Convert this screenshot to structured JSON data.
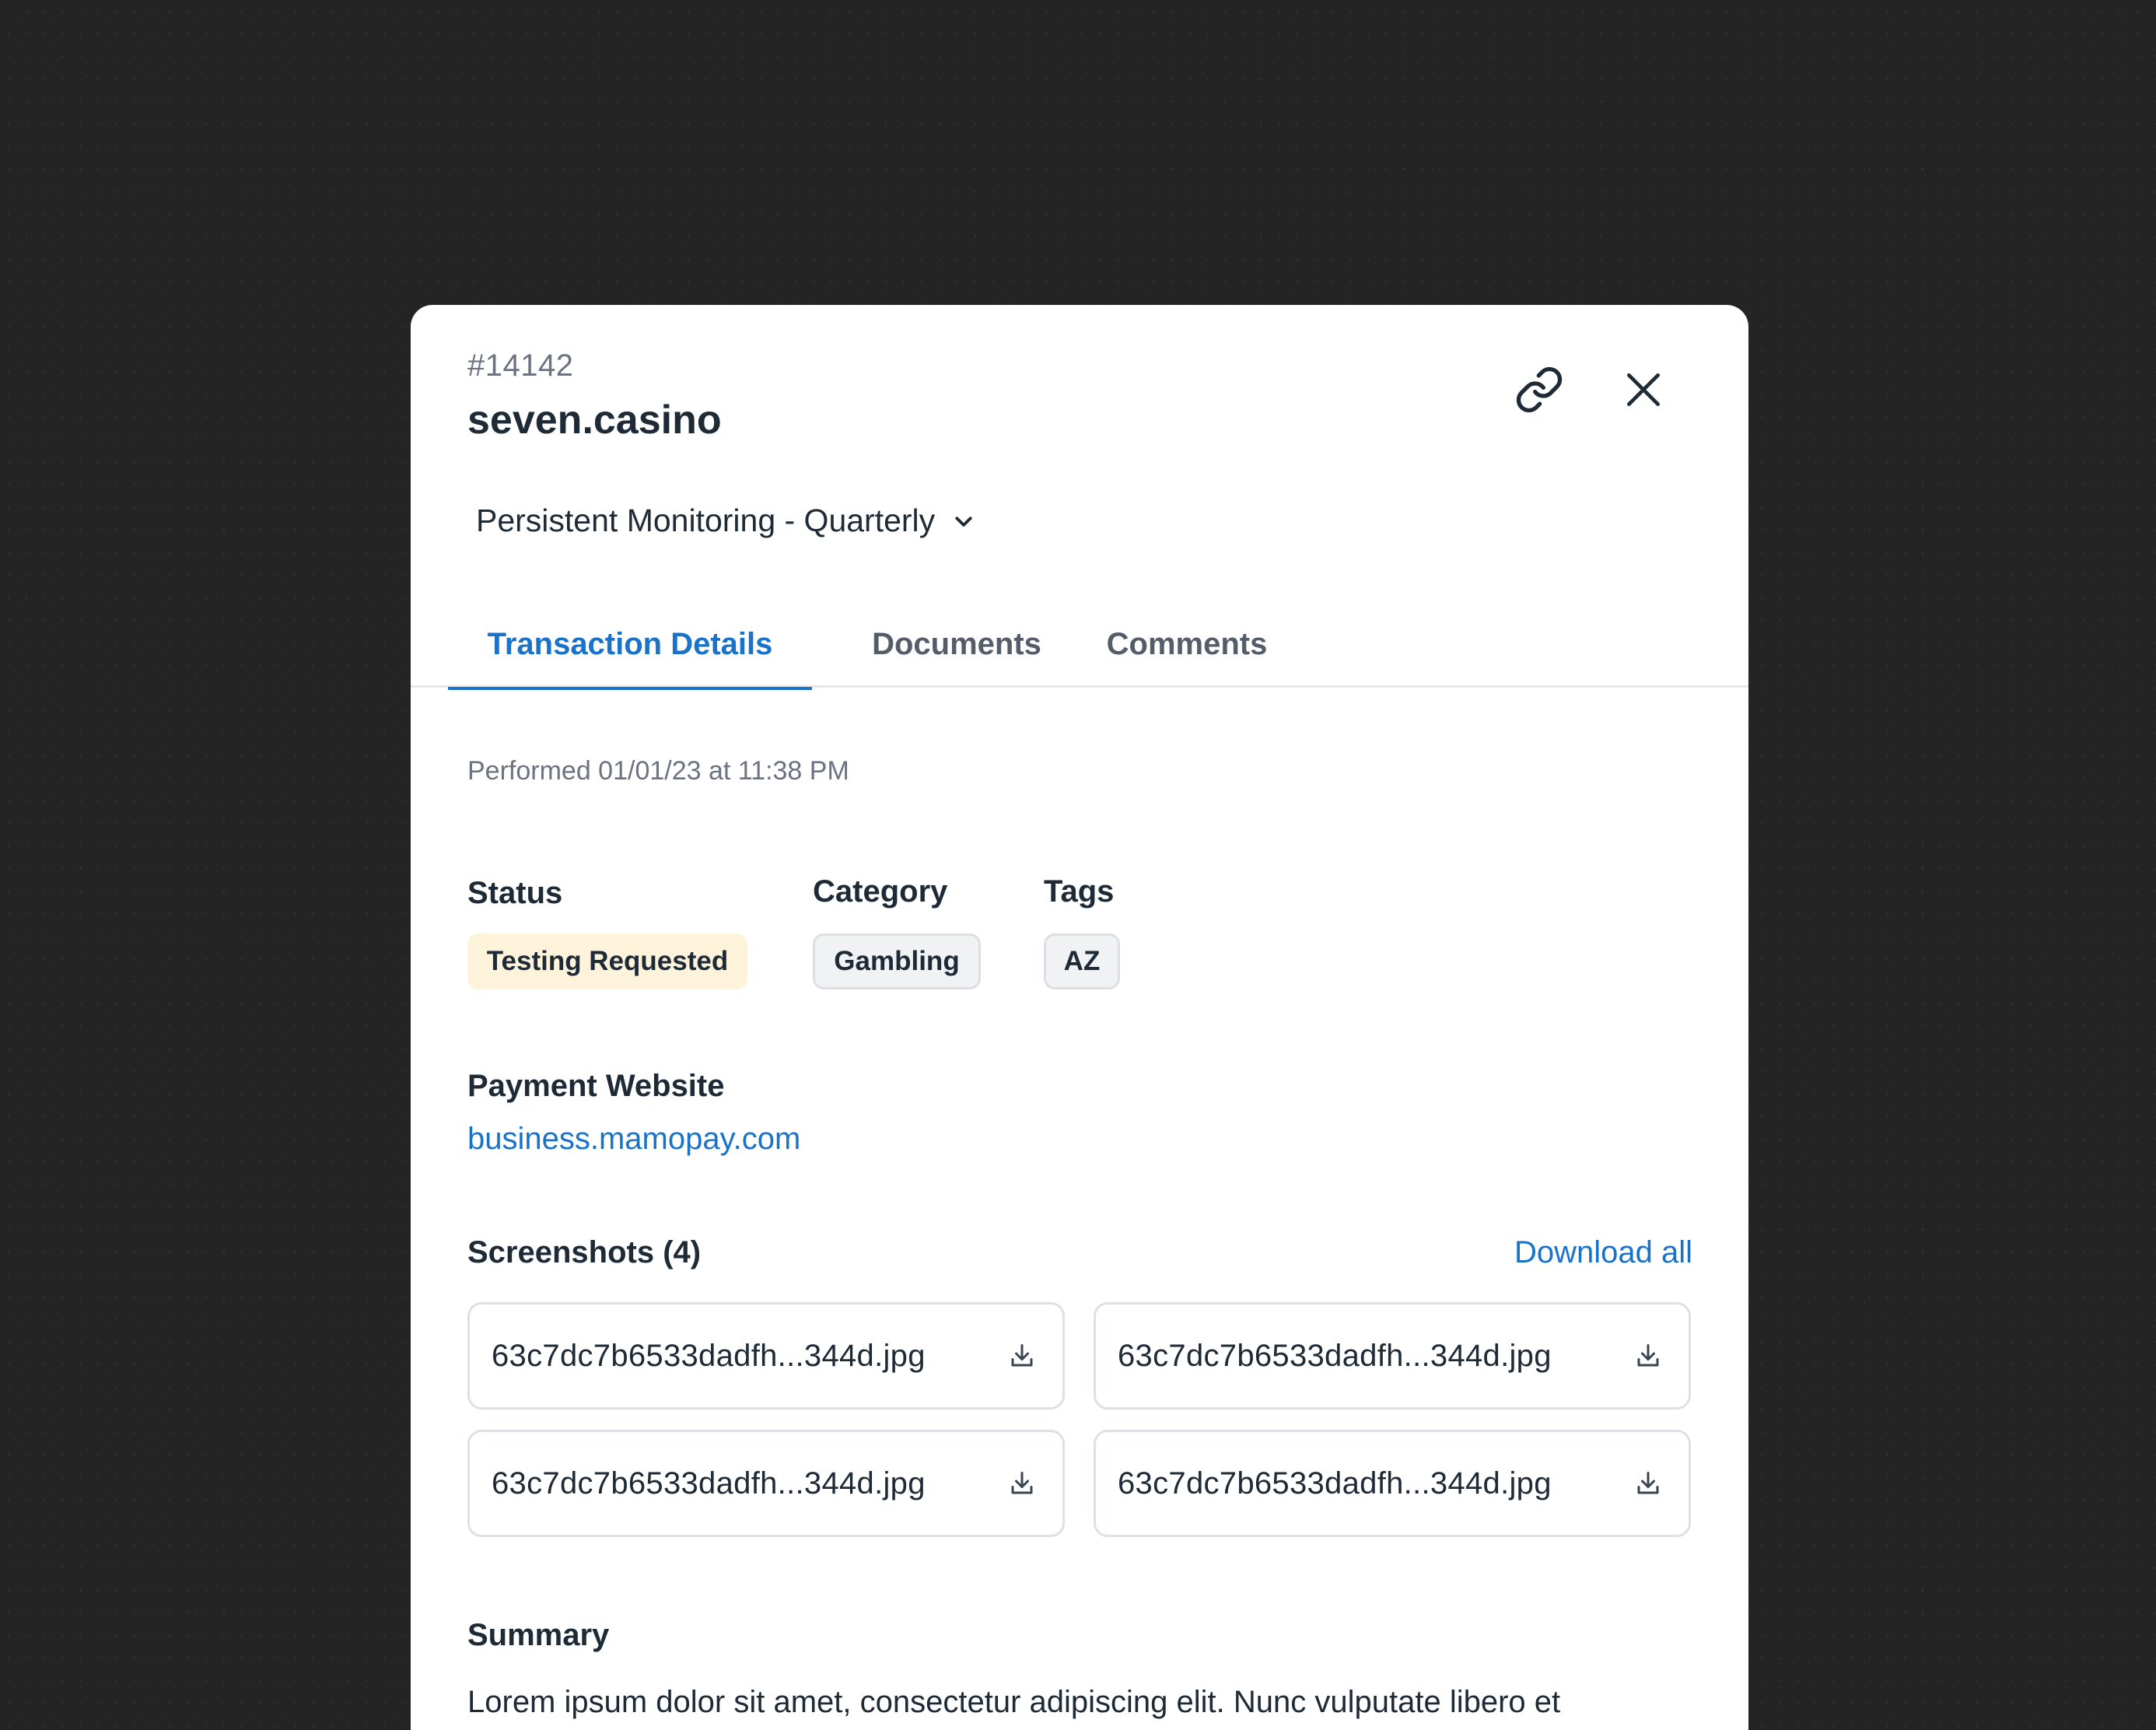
{
  "header": {
    "ticket_id": "#14142",
    "title": "seven.casino"
  },
  "icons": {
    "link": "link-icon",
    "close": "close-icon",
    "chevron": "chevron-down-icon",
    "download": "download-icon"
  },
  "monitoring": {
    "selected": "Persistent Monitoring - Quarterly"
  },
  "tabs": [
    {
      "label": "Transaction Details",
      "active": true
    },
    {
      "label": "Documents",
      "active": false
    },
    {
      "label": "Comments",
      "active": false
    }
  ],
  "details": {
    "performed": "Performed 01/01/23 at 11:38 PM",
    "status_label": "Status",
    "status_value": "Testing Requested",
    "category_label": "Category",
    "category_value": "Gambling",
    "tags_label": "Tags",
    "tags": [
      "AZ"
    ],
    "website_label": "Payment Website",
    "website_value": "business.mamopay.com"
  },
  "screenshots": {
    "label": "Screenshots (4)",
    "download_all": "Download all",
    "files": [
      "63c7dc7b6533dadfh...344d.jpg",
      "63c7dc7b6533dadfh...344d.jpg",
      "63c7dc7b6533dadfh...344d.jpg",
      "63c7dc7b6533dadfh...344d.jpg"
    ]
  },
  "summary": {
    "label": "Summary",
    "text": "Lorem ipsum dolor sit amet, consectetur adipiscing elit. Nunc vulputate libero et"
  },
  "colors": {
    "accent": "#1a73c8",
    "status_badge_bg": "#fdf3db",
    "backdrop": "#242424"
  }
}
